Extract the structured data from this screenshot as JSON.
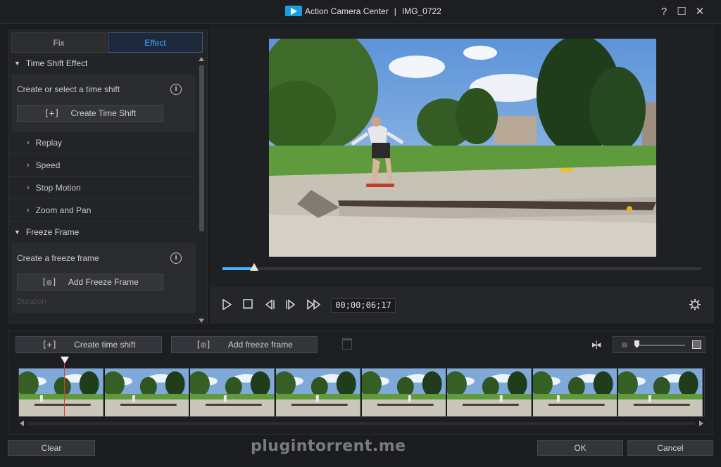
{
  "window": {
    "app_name": "Action Camera Center",
    "separator": "|",
    "file_name": "IMG_0722",
    "help_label": "?",
    "maximize_label": "☐",
    "close_label": "✕"
  },
  "tabs": [
    {
      "label": "Fix",
      "active": false
    },
    {
      "label": "Effect",
      "active": true
    }
  ],
  "time_shift": {
    "section_label": "Time Shift Effect",
    "prompt": "Create or select a time shift",
    "button_label": "Create Time Shift",
    "items": [
      "Replay",
      "Speed",
      "Stop Motion",
      "Zoom and Pan"
    ]
  },
  "freeze_frame": {
    "section_label": "Freeze Frame",
    "prompt": "Create a freeze frame",
    "button_label": "Add Freeze Frame",
    "faded_label": "Duration"
  },
  "player": {
    "timecode": "00;00;06;17",
    "progress_fraction": 0.066
  },
  "timeline": {
    "create_button": "Create time shift",
    "freeze_button": "Add freeze frame",
    "frame_count": 8
  },
  "footer": {
    "clear_label": "Clear",
    "ok_label": "OK",
    "cancel_label": "Cancel",
    "watermark": "plugintorrent.me"
  },
  "colors": {
    "accent": "#46a6ff",
    "seek_fill": "#49b3ff",
    "playhead": "#e23a3a"
  },
  "icons": [
    "app-logo-icon",
    "help-icon",
    "maximize-icon",
    "close-icon",
    "info-icon",
    "create-time-shift-icon",
    "add-freeze-frame-icon",
    "play-icon",
    "stop-icon",
    "prev-frame-icon",
    "next-frame-icon",
    "fast-forward-icon",
    "settings-gear-icon",
    "trash-icon",
    "fit-timeline-icon",
    "zoom-out-icon",
    "zoom-in-icon"
  ]
}
